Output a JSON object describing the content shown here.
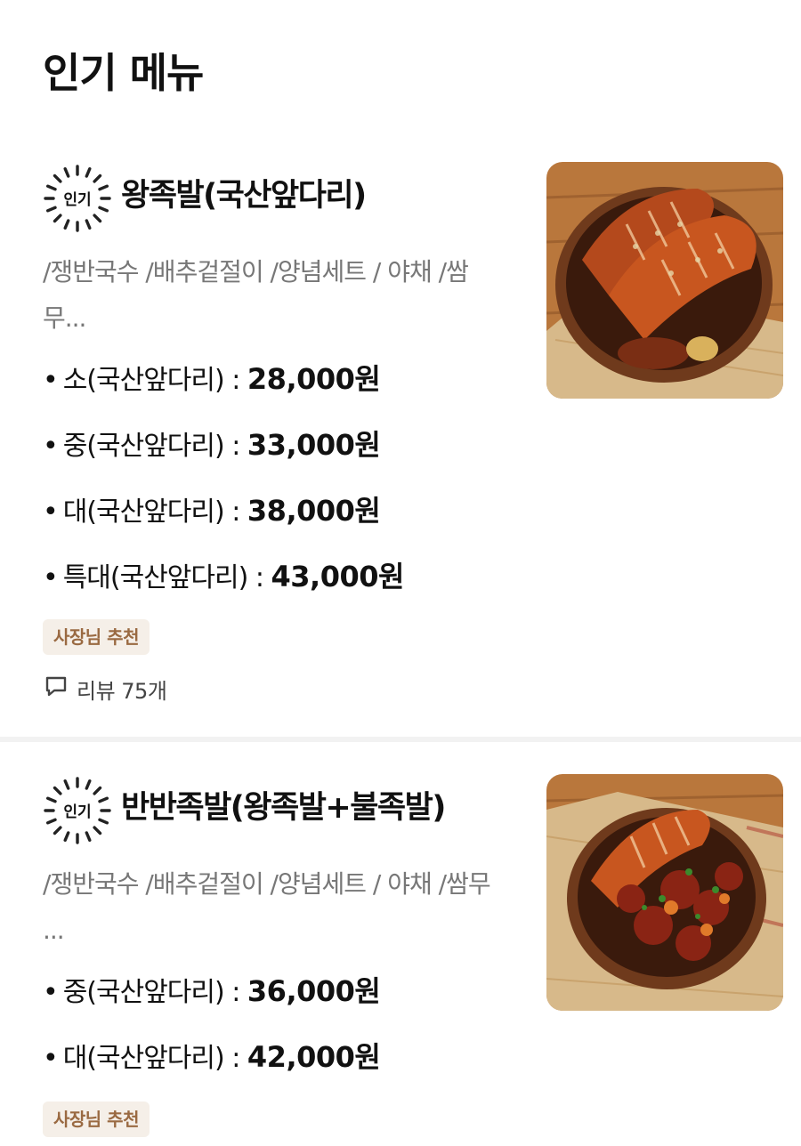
{
  "page": {
    "title": "인기 메뉴"
  },
  "colors": {
    "tag_bg": "#f5efe8",
    "tag_text": "#9a6a42",
    "desc_text": "#777777"
  },
  "menu": [
    {
      "badge": "인기",
      "name": "왕족발(국산앞다리)",
      "description": "/쟁반국수 /배추겉절이 /양념세트 / 야채 /쌈무...",
      "prices": [
        {
          "label": "소(국산앞다리) : ",
          "amount": "28,000원"
        },
        {
          "label": "중(국산앞다리) : ",
          "amount": "33,000원"
        },
        {
          "label": "대(국산앞다리) : ",
          "amount": "38,000원"
        },
        {
          "label": "특대(국산앞다리) : ",
          "amount": "43,000원"
        }
      ],
      "tag": "사장님 추천",
      "review_label": "리뷰 75개",
      "image_icon": "braised-pork-trotters-photo"
    },
    {
      "badge": "인기",
      "name": "반반족발(왕족발+불족발)",
      "description": "/쟁반국수 /배추겉절이 /양념세트 / 야채 /쌈무 ...",
      "prices": [
        {
          "label": "중(국산앞다리) : ",
          "amount": "36,000원"
        },
        {
          "label": "대(국산앞다리) : ",
          "amount": "42,000원"
        }
      ],
      "tag": "사장님 추천",
      "image_icon": "half-and-half-trotters-photo"
    }
  ]
}
